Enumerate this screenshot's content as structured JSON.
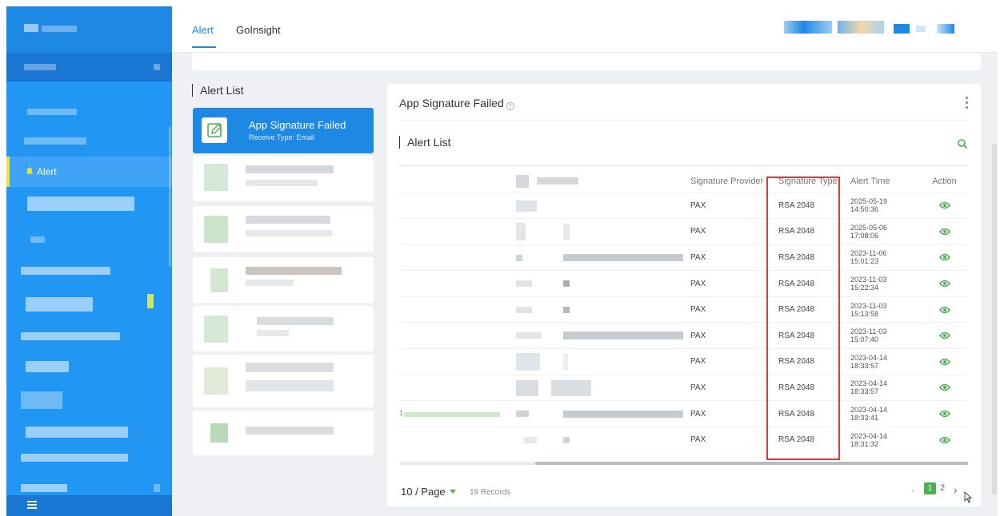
{
  "sidebar": {
    "active_item": {
      "label": "Alert",
      "icon": "bell-icon"
    },
    "menu_icon": "hamburger-icon"
  },
  "tabs": [
    {
      "label": "Alert",
      "active": true
    },
    {
      "label": "GoInsight",
      "active": false
    }
  ],
  "alert_list": {
    "title": "Alert List",
    "selected_card": {
      "title": "App Signature Failed",
      "subtitle": "Receive Type:  Email",
      "icon": "edit-icon"
    }
  },
  "detail": {
    "title": "App Signature Failed",
    "help_icon": "?",
    "list_title": "Alert List",
    "columns": [
      "Signature Provider",
      "Signature Type",
      "Alert Time",
      "Action"
    ],
    "rows": [
      {
        "provider": "PAX",
        "type": "RSA 2048",
        "date": "2025-05-19",
        "time": "14:50:36"
      },
      {
        "provider": "PAX",
        "type": "RSA 2048",
        "date": "2025-05-06",
        "time": "17:08:06"
      },
      {
        "provider": "PAX",
        "type": "RSA 2048",
        "date": "2023-11-06",
        "time": "15:01:23"
      },
      {
        "provider": "PAX",
        "type": "RSA 2048",
        "date": "2023-11-03",
        "time": "15:22:34"
      },
      {
        "provider": "PAX",
        "type": "RSA 2048",
        "date": "2023-11-03",
        "time": "15:13:58"
      },
      {
        "provider": "PAX",
        "type": "RSA 2048",
        "date": "2023-11-03",
        "time": "15:07:40"
      },
      {
        "provider": "PAX",
        "type": "RSA 2048",
        "date": "2023-04-14",
        "time": "18:33:57"
      },
      {
        "provider": "PAX",
        "type": "RSA 2048",
        "date": "2023-04-14",
        "time": "18:33:57"
      },
      {
        "provider": "PAX",
        "type": "RSA 2048",
        "date": "2023-04-14",
        "time": "18:33:41"
      },
      {
        "provider": "PAX",
        "type": "RSA 2048",
        "date": "2023-04-14",
        "time": "18:31:32"
      }
    ],
    "row_prefix_9": "1",
    "pagination": {
      "page_size": "10 / Page",
      "records": "19 Records",
      "current": "1",
      "next_page": "2"
    }
  },
  "colors": {
    "sidebar": "#2196f3",
    "accent": "#1e88e5",
    "action_green": "#4caf50",
    "highlight": "#ee3333"
  }
}
